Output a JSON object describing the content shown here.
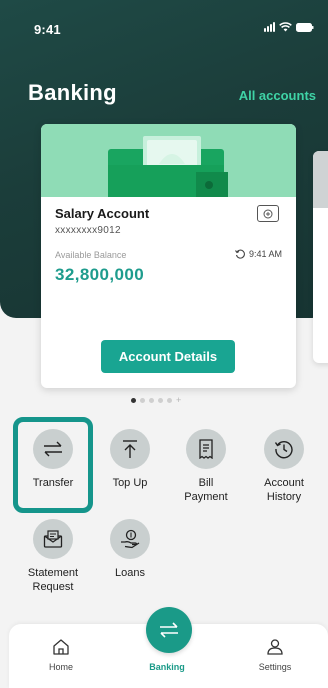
{
  "status": {
    "time": "9:41"
  },
  "header": {
    "title": "Banking",
    "all_accounts": "All accounts"
  },
  "account_card": {
    "name": "Salary Account",
    "number": "xxxxxxxx9012",
    "balance_label": "Available Balance",
    "updated_time": "9:41 AM",
    "balance": "32,800,000",
    "button_label": "Account Details"
  },
  "carousel": {
    "page": 1,
    "total": 5
  },
  "actions": [
    {
      "label": "Transfer",
      "icon": "transfer-icon"
    },
    {
      "label": "Top Up",
      "icon": "top-up-icon"
    },
    {
      "label": "Bill\nPayment",
      "icon": "bill-icon"
    },
    {
      "label": "Account\nHistory",
      "icon": "history-icon"
    },
    {
      "label": "Statement\nRequest",
      "icon": "statement-icon"
    },
    {
      "label": "Loans",
      "icon": "loans-icon"
    }
  ],
  "tabbar": {
    "home": "Home",
    "banking": "Banking",
    "settings": "Settings"
  },
  "colors": {
    "accent": "#19a592",
    "highlight": "#15958b",
    "header_bg": "#1b3d3a",
    "link": "#3fd3a6"
  }
}
